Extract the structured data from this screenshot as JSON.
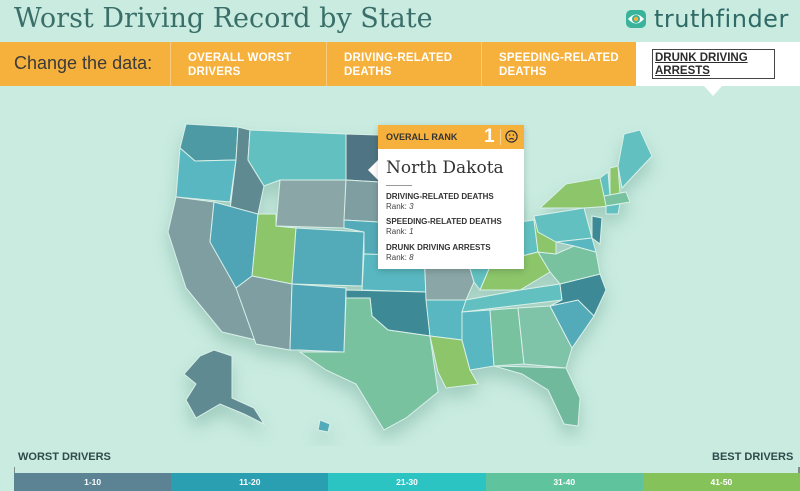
{
  "header": {
    "title": "Worst Driving Record by State",
    "brand": "truthfinder"
  },
  "nav": {
    "label": "Change the data:",
    "items": [
      {
        "line1": "OVERALL WORST",
        "line2": "DRIVERS"
      },
      {
        "line1": "DRIVING-RELATED",
        "line2": "DEATHS"
      },
      {
        "line1": "SPEEDING-RELATED",
        "line2": "DEATHS"
      }
    ],
    "active": {
      "line1": "DRUNK DRIVING",
      "line2": "ARRESTS"
    }
  },
  "tooltip": {
    "head_label": "OVERALL RANK",
    "rank": "1",
    "state": "North Dakota",
    "metrics": [
      {
        "label": "DRIVING-RELATED DEATHS",
        "rank_label": "Rank:",
        "rank": "3"
      },
      {
        "label": "SPEEDING-RELATED DEATHS",
        "rank_label": "Rank:",
        "rank": "1"
      },
      {
        "label": "DRUNK DRIVING ARRESTS",
        "rank_label": "Rank:",
        "rank": "8"
      }
    ]
  },
  "legend": {
    "worst_label": "WORST DRIVERS",
    "best_label": "BEST DRIVERS",
    "buckets": [
      {
        "label": "1-10",
        "color": "#5b8393"
      },
      {
        "label": "11-20",
        "color": "#2a9fb2"
      },
      {
        "label": "21-30",
        "color": "#2cc3c3"
      },
      {
        "label": "31-40",
        "color": "#5fc39e"
      },
      {
        "label": "41-50",
        "color": "#86c25a"
      }
    ]
  },
  "colors": {
    "accent": "#f6b03c",
    "background": "#c9ebe0",
    "title": "#3a6f69"
  }
}
